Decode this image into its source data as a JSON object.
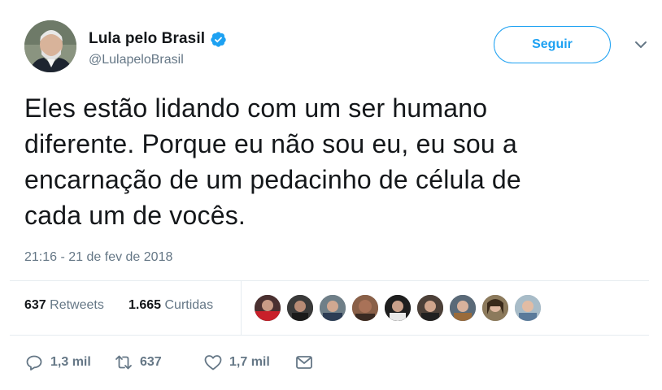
{
  "account": {
    "name": "Lula pelo Brasil",
    "handle": "@LulapeloBrasil",
    "verified": true
  },
  "follow_button": {
    "label": "Seguir"
  },
  "tweet": {
    "text": "Eles estão lidando com um ser humano\ndiferente. Porque eu não sou eu, eu sou a\nencarnação de um pedacinho de célula de\ncada um de vocês.",
    "timestamp": "21:16 - 21 de fev de 2018"
  },
  "stats": {
    "retweets_count": "637",
    "retweets_label": "Retweets",
    "likes_count": "1.665",
    "likes_label": "Curtidas",
    "likers_shown": 9
  },
  "actions": {
    "reply_count": "1,3 mil",
    "retweet_count": "637",
    "like_count": "1,7 mil"
  },
  "colors": {
    "accent": "#1da1f2",
    "text": "#14171a",
    "secondary": "#657786",
    "divider": "#e6ecf0"
  },
  "icons": [
    "verified-badge-icon",
    "chevron-down-icon",
    "reply-icon",
    "retweet-icon",
    "heart-icon",
    "envelope-icon"
  ]
}
